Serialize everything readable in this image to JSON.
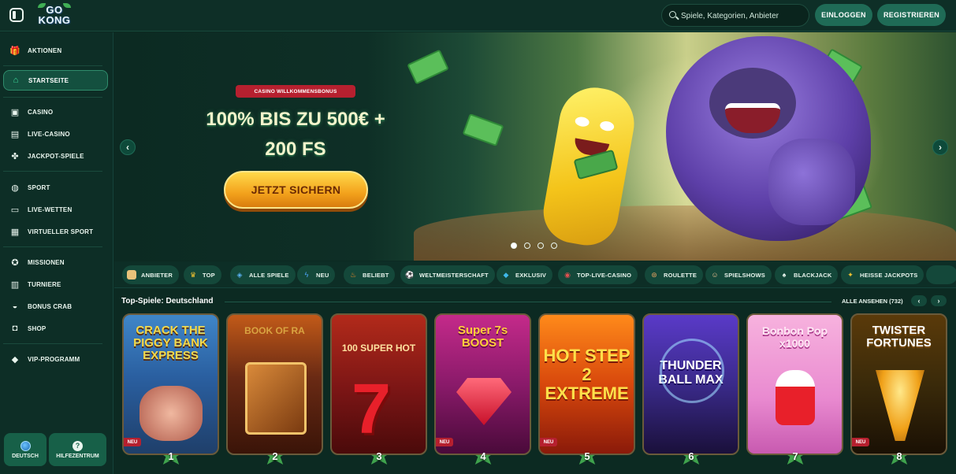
{
  "header": {
    "logo_text_top": "GO",
    "logo_text_bottom": "KONG",
    "search_placeholder": "Spiele, Kategorien, Anbieter",
    "login_label": "EINLOGGEN",
    "register_label": "REGISTRIEREN"
  },
  "sidebar": {
    "items": [
      {
        "label": "AKTIONEN",
        "icon": "gift-icon"
      },
      {
        "label": "STARTSEITE",
        "icon": "home-icon",
        "active": true
      },
      {
        "label": "CASINO",
        "icon": "slot-machine-icon"
      },
      {
        "label": "LIVE-CASINO",
        "icon": "cards-icon"
      },
      {
        "label": "JACKPOT-SPIELE",
        "icon": "clover-icon"
      },
      {
        "label": "SPORT",
        "icon": "ball-icon"
      },
      {
        "label": "LIVE-WETTEN",
        "icon": "live-icon"
      },
      {
        "label": "VIRTUELLER SPORT",
        "icon": "virtual-sport-icon"
      },
      {
        "label": "MISSIONEN",
        "icon": "medal-icon"
      },
      {
        "label": "TURNIERE",
        "icon": "podium-icon"
      },
      {
        "label": "BONUS CRAB",
        "icon": "crab-icon"
      },
      {
        "label": "SHOP",
        "icon": "bag-icon"
      },
      {
        "label": "VIP-PROGRAMM",
        "icon": "diamond-icon"
      }
    ],
    "language_label": "DEUTSCH",
    "help_label": "HILFEZENTRUM"
  },
  "banner": {
    "badge": "CASINO WILLKOMMENSBONUS",
    "headline_line1": "100% BIS ZU 500€ +",
    "headline_line2": "200 FS",
    "cta_label": "JETZT SICHERN",
    "slides_total": 4,
    "active_slide": 1
  },
  "categories": [
    {
      "label": "ANBIETER",
      "icon": "scroll-icon",
      "color": "#e8c27a"
    },
    {
      "label": "TOP",
      "icon": "crown-icon",
      "color": "#f2c230"
    },
    {
      "label": "ALLE SPIELE",
      "icon": "controller-icon",
      "color": "#5ab0f0"
    },
    {
      "label": "NEU",
      "icon": "lightning-icon",
      "color": "#4fa8ff"
    },
    {
      "label": "BELIEBT",
      "icon": "fire-icon",
      "color": "#f08a2a"
    },
    {
      "label": "WELTMEISTERSCHAFT",
      "icon": "football-icon",
      "color": "#ffffff"
    },
    {
      "label": "EXKLUSIV",
      "icon": "gem-icon",
      "color": "#3fb8e8"
    },
    {
      "label": "TOP-LIVE-CASINO",
      "icon": "chip-icon",
      "color": "#e05050"
    },
    {
      "label": "ROULETTE",
      "icon": "roulette-icon",
      "color": "#e0a060"
    },
    {
      "label": "SPIELSHOWS",
      "icon": "showman-icon",
      "color": "#f0c090"
    },
    {
      "label": "BLACKJACK",
      "icon": "blackjack-icon",
      "color": "#e9f5ee"
    },
    {
      "label": "HEISSE JACKPOTS",
      "icon": "jackpot-icon",
      "color": "#f2c230"
    }
  ],
  "section": {
    "title": "Top-Spiele: Deutschland",
    "view_all": "ALLE ANSEHEN (732)"
  },
  "games": [
    {
      "title": "CRACK THE PIGGY BANK EXPRESS",
      "rank": "1",
      "badge": "NEU",
      "bg": "#2a5fa0",
      "accent": "#f3d94a"
    },
    {
      "title": "BOOK OF RA",
      "rank": "2",
      "badge": "",
      "bg": "#6a2a14",
      "accent": "#d9a441"
    },
    {
      "title": "100 SUPER HOT",
      "rank": "3",
      "badge": "",
      "bg": "#7a1515",
      "accent": "#ff5a3a"
    },
    {
      "title": "Super 7s BOOST",
      "rank": "4",
      "badge": "NEU",
      "bg": "#8a1a6a",
      "accent": "#ffcf3a"
    },
    {
      "title": "HOT STEP 2 EXTREME",
      "rank": "5",
      "badge": "NEU",
      "bg": "#d8480c",
      "accent": "#ffe04a"
    },
    {
      "title": "THUNDER BALL MAX",
      "rank": "6",
      "badge": "",
      "bg": "#3a2a8a",
      "accent": "#9fd8ff"
    },
    {
      "title": "Bonbon Pop x1000",
      "rank": "7",
      "badge": "",
      "bg": "#e98ad0",
      "accent": "#ffe7f4"
    },
    {
      "title": "TWISTER FORTUNES",
      "rank": "8",
      "badge": "NEU",
      "bg": "#3a2a0a",
      "accent": "#ffd24a"
    }
  ]
}
